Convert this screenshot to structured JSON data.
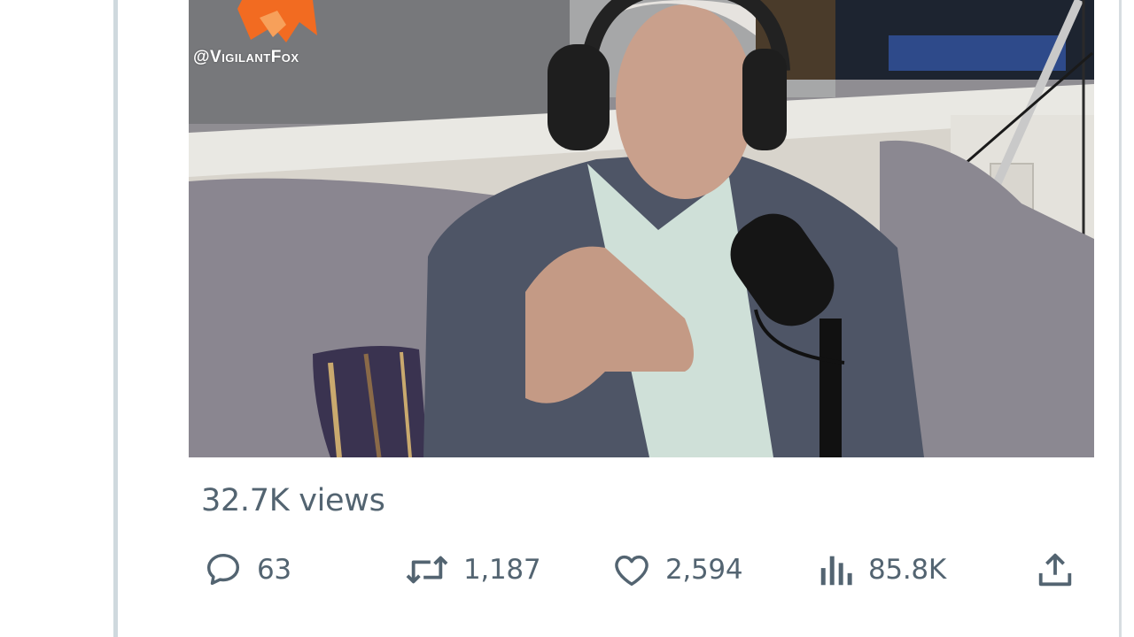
{
  "video": {
    "watermark": "@VigilantFox",
    "accent_color": "#f26b21"
  },
  "stats": {
    "views": "32.7K views"
  },
  "actions": {
    "replies": "63",
    "reposts": "1,187",
    "likes": "2,594",
    "analytics": "85.8K"
  },
  "icons": [
    "reply-icon",
    "repost-icon",
    "like-icon",
    "analytics-icon",
    "share-icon"
  ],
  "colors": {
    "text_secondary": "#536471",
    "border": "#cfd9de",
    "background": "#ffffff"
  }
}
